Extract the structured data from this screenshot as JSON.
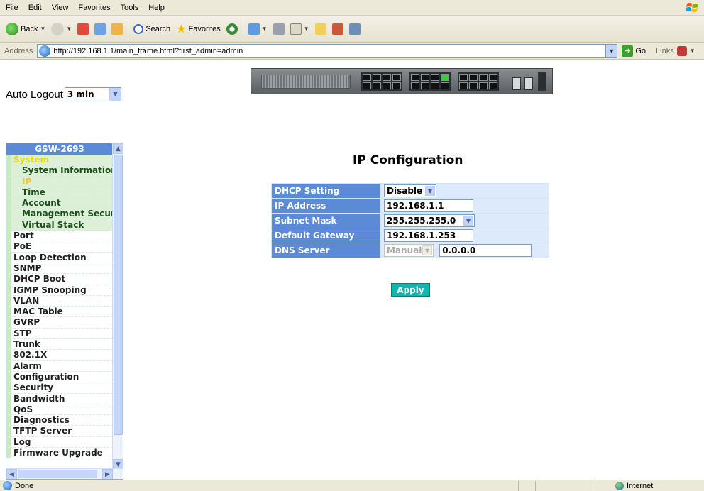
{
  "browser": {
    "menu": [
      "File",
      "Edit",
      "View",
      "Favorites",
      "Tools",
      "Help"
    ],
    "toolbar": {
      "back_label": "Back",
      "search_label": "Search",
      "favorites_label": "Favorites"
    },
    "address": {
      "label": "Address",
      "url": "http://192.168.1.1/main_frame.html?first_admin=admin",
      "go_label": "Go",
      "links_label": "Links"
    },
    "status": {
      "text": "Done",
      "zone": "Internet"
    }
  },
  "header": {
    "auto_logout_label": "Auto Logout",
    "auto_logout_value": "3 min"
  },
  "sidebar": {
    "title": "GSW-2693",
    "items": [
      {
        "label": "System",
        "level": 0,
        "state": "open"
      },
      {
        "label": "System Information",
        "level": 1
      },
      {
        "label": "IP",
        "level": 1,
        "state": "active"
      },
      {
        "label": "Time",
        "level": 1
      },
      {
        "label": "Account",
        "level": 1
      },
      {
        "label": "Management Security",
        "level": 1
      },
      {
        "label": "Virtual Stack",
        "level": 1
      },
      {
        "label": "Port",
        "level": 0
      },
      {
        "label": "PoE",
        "level": 0
      },
      {
        "label": "Loop Detection",
        "level": 0
      },
      {
        "label": "SNMP",
        "level": 0
      },
      {
        "label": "DHCP Boot",
        "level": 0
      },
      {
        "label": "IGMP Snooping",
        "level": 0
      },
      {
        "label": "VLAN",
        "level": 0
      },
      {
        "label": "MAC Table",
        "level": 0
      },
      {
        "label": "GVRP",
        "level": 0
      },
      {
        "label": "STP",
        "level": 0
      },
      {
        "label": "Trunk",
        "level": 0
      },
      {
        "label": "802.1X",
        "level": 0
      },
      {
        "label": "Alarm",
        "level": 0
      },
      {
        "label": "Configuration",
        "level": 0
      },
      {
        "label": "Security",
        "level": 0
      },
      {
        "label": "Bandwidth",
        "level": 0
      },
      {
        "label": "QoS",
        "level": 0
      },
      {
        "label": "Diagnostics",
        "level": 0
      },
      {
        "label": "TFTP Server",
        "level": 0
      },
      {
        "label": "Log",
        "level": 0
      },
      {
        "label": "Firmware Upgrade",
        "level": 0
      }
    ]
  },
  "main": {
    "title": "IP Configuration",
    "form": {
      "dhcp_label": "DHCP Setting",
      "dhcp_value": "Disable",
      "ip_label": "IP Address",
      "ip_value": "192.168.1.1",
      "mask_label": "Subnet Mask",
      "mask_value": "255.255.255.0",
      "gateway_label": "Default Gateway",
      "gateway_value": "192.168.1.253",
      "dns_label": "DNS Server",
      "dns_mode": "Manual",
      "dns_value": "0.0.0.0"
    },
    "apply_label": "Apply"
  },
  "colors": {
    "menu_header": "#5b8ad6",
    "label_cell": "#5b8ad6",
    "value_cell": "#ddeafb",
    "active_item": "#f0d010",
    "apply_button": "#12b4b0"
  }
}
